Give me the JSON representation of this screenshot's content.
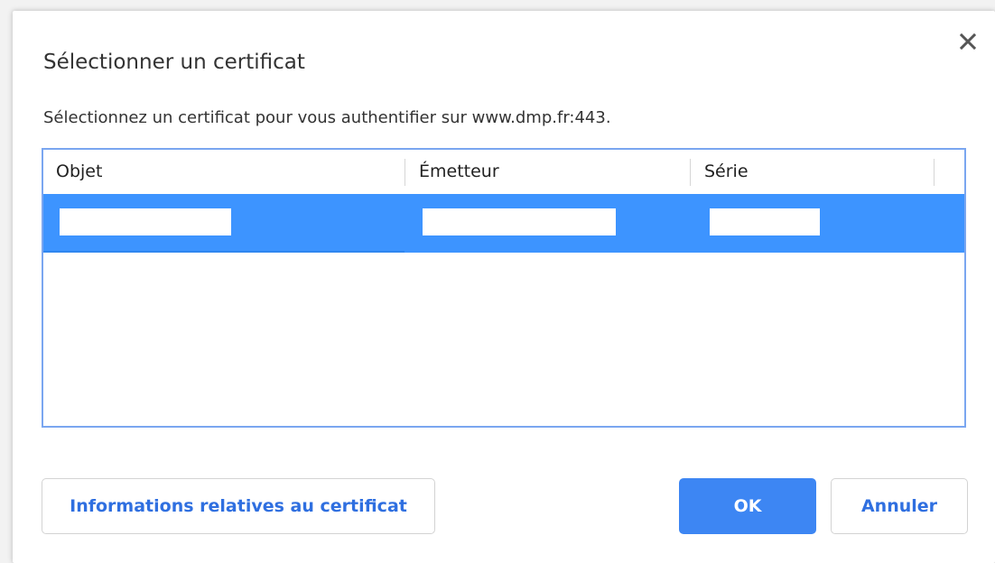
{
  "dialog": {
    "title": "Sélectionner un certificat",
    "subtitle": "Sélectionnez un certificat pour vous authentifier sur www.dmp.fr:443.",
    "close_icon": "close-icon"
  },
  "table": {
    "columns": [
      "Objet",
      "Émetteur",
      "Série"
    ],
    "selected_row_color": "#3d94ff",
    "rows": [
      {
        "objet": "",
        "emetteur": "",
        "serie": "",
        "selected": true
      }
    ]
  },
  "buttons": {
    "info_label": "Informations relatives au certificat",
    "ok_label": "OK",
    "cancel_label": "Annuler"
  },
  "colors": {
    "accent": "#3d86f3",
    "link_text": "#2f6fe0",
    "table_border": "#7aa6f0"
  }
}
